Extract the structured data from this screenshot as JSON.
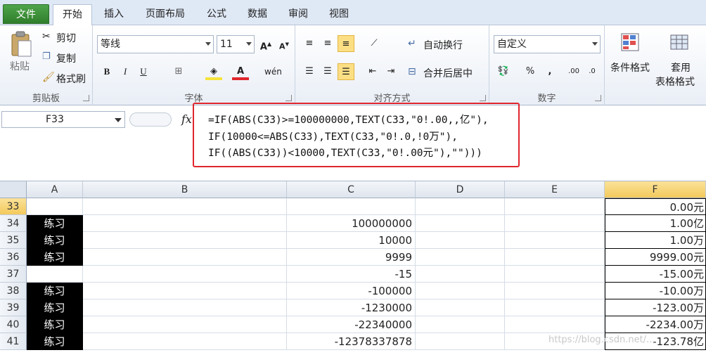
{
  "ribbon_tabs": [
    "文件",
    "开始",
    "插入",
    "页面布局",
    "公式",
    "数据",
    "审阅",
    "视图"
  ],
  "clipboard": {
    "paste": "粘贴",
    "cut": "剪切",
    "copy": "复制",
    "format_painter": "格式刷",
    "label": "剪贴板"
  },
  "font": {
    "name": "等线",
    "size": "11",
    "label": "字体"
  },
  "alignment": {
    "wrap": "自动换行",
    "merge": "合并后居中",
    "label": "对齐方式"
  },
  "number": {
    "format": "自定义",
    "label": "数字",
    "percent": "%",
    "comma": ","
  },
  "styles": {
    "conditional": "条件格式",
    "table_line1": "套用",
    "table_line2": "表格格式"
  },
  "formula_bar": {
    "name_box": "F33",
    "fx": "fx",
    "line1": "=IF(ABS(C33)>=100000000,TEXT(C33,\"0!.00,,亿\"),",
    "line2": "IF(10000<=ABS(C33),TEXT(C33,\"0!.0,!0万\"),",
    "line3": "IF((ABS(C33))<10000,TEXT(C33,\"0!.00元\"),\"\")))"
  },
  "columns": [
    "A",
    "B",
    "C",
    "D",
    "E",
    "F"
  ],
  "rows": [
    {
      "num": "33",
      "a": "",
      "c": "",
      "f": "0.00元"
    },
    {
      "num": "34",
      "a": "练习",
      "c": "100000000",
      "f": "1.00亿"
    },
    {
      "num": "35",
      "a": "练习",
      "c": "10000",
      "f": "1.00万"
    },
    {
      "num": "36",
      "a": "练习",
      "c": "9999",
      "f": "9999.00元"
    },
    {
      "num": "37",
      "a": "",
      "c": "-15",
      "f": "-15.00元"
    },
    {
      "num": "38",
      "a": "练习",
      "c": "-100000",
      "f": "-10.00万"
    },
    {
      "num": "39",
      "a": "练习",
      "c": "-1230000",
      "f": "-123.00万"
    },
    {
      "num": "40",
      "a": "练习",
      "c": "-22340000",
      "f": "-2234.00万"
    },
    {
      "num": "41",
      "a": "练习",
      "c": "-12378337878",
      "f": "-123.78亿"
    }
  ],
  "watermark": "https://blog.csdn.net/..."
}
